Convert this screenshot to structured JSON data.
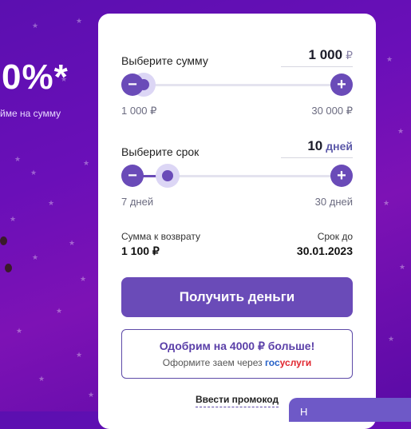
{
  "promo": {
    "headline": "0%*",
    "subline": "йме на сумму"
  },
  "amount": {
    "label": "Выберите сумму",
    "value": "1 000",
    "unit": "₽",
    "min_label": "1 000 ₽",
    "max_label": "30 000 ₽",
    "position_fraction": 0.0
  },
  "term": {
    "label": "Выберите срок",
    "value": "10",
    "unit": "дней",
    "min_label": "7 дней",
    "max_label": "30 дней",
    "position_fraction": 0.13
  },
  "summary": {
    "return_label": "Сумма к возврату",
    "return_value": "1 100 ₽",
    "due_label": "Срок до",
    "due_value": "30.01.2023"
  },
  "cta": {
    "label": "Получить деньги"
  },
  "offer": {
    "title": "Одобрим на 4000 ₽ больше!",
    "subtitle_prefix": "Оформите заем через ",
    "gos_part": "гос",
    "uslugi_part": "услуги"
  },
  "promocode_link": "Ввести промокод",
  "chat_teaser": "Н",
  "icons": {
    "minus": "minus-icon",
    "plus": "plus-icon"
  },
  "colors": {
    "accent": "#6a4bb8",
    "background_top": "#5b0fb0",
    "background_mid": "#7d12b5"
  }
}
